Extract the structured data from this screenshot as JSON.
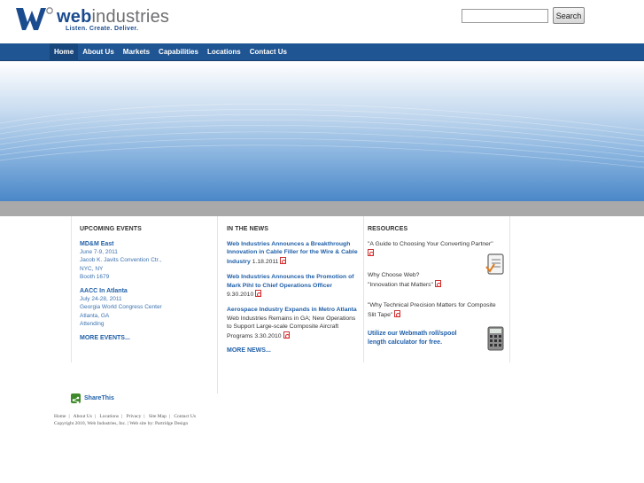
{
  "header": {
    "logo_word_a": "web",
    "logo_word_b": "industries",
    "tagline": "Listen. Create. Deliver.",
    "search_placeholder": "",
    "search_button": "Search"
  },
  "nav": {
    "items": [
      "Home",
      "About Us",
      "Markets",
      "Capabilities",
      "Locations",
      "Contact Us"
    ]
  },
  "events": {
    "heading": "UPCOMING EVENTS",
    "items": [
      {
        "title": "MD&M East",
        "lines": [
          "June 7-9, 2011",
          "Jacob K. Javits Convention Ctr.,",
          "NYC, NY",
          "Booth 1679"
        ]
      },
      {
        "title": "AACC In Atlanta",
        "lines": [
          "July 24-28, 2011",
          "Georgia World Congress Center",
          "Atlanta, GA",
          "Attending"
        ]
      }
    ],
    "more": "MORE EVENTS..."
  },
  "news": {
    "heading": "IN THE NEWS",
    "items": [
      {
        "title": "Web Industries Announces a Breakthrough Innovation in Cable Filler for the Wire & Cable Industry",
        "text": " 1.18.2011"
      },
      {
        "title": "Web Industries Announces the Promotion of Mark Pihl to Chief Operations Officer",
        "text": "9.30.2010"
      },
      {
        "title": "Aerospace Industry Expands in Metro Atlanta",
        "text": " Web Industries Remains in GA; New Operations to Support Large-scale Composite Aircraft Programs 3.30.2010"
      }
    ],
    "more": "MORE NEWS..."
  },
  "resources": {
    "heading": "RESOURCES",
    "items": [
      "\"A Guide to Choosing Your Converting Partner\"",
      "Why Choose Web?",
      "\"Innovation that Matters\"",
      "\"Why Technical Precision Matters for Composite Slit Tape\""
    ],
    "calculator_link": "Utilize our Webmath roll/spool length calculator for free."
  },
  "footer": {
    "share": "ShareThis",
    "links": [
      "Home",
      "About Us",
      "Locations",
      "Privacy",
      "Site Map",
      "Contact Us"
    ],
    "copyright": "Copyright 2010, Web Industries, Inc. | Web site by: Partridge Design"
  },
  "colors": {
    "nav_bg": "#1f5593",
    "link": "#1f5fa8",
    "band": "#a9a9a9",
    "share_green": "#3f8a2a"
  },
  "icons": [
    "logo-w-mark",
    "pdf-icon",
    "document-check-icon",
    "calculator-icon",
    "share-icon"
  ]
}
